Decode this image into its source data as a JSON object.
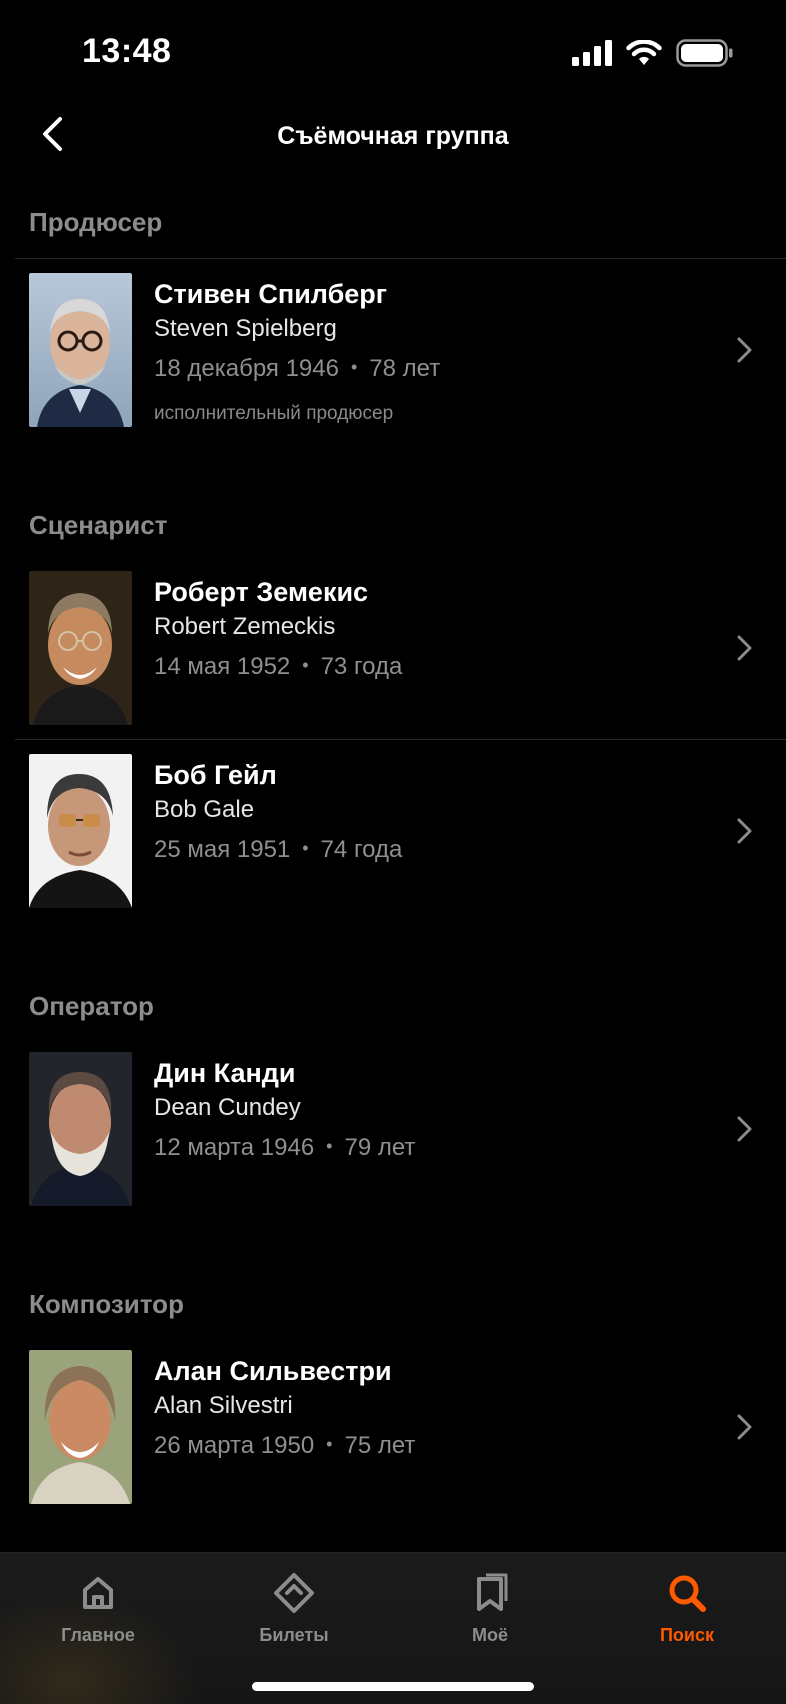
{
  "status_bar": {
    "time": "13:48"
  },
  "nav": {
    "title": "Съёмочная группа"
  },
  "sections": [
    {
      "title": "Продюсер",
      "people": [
        {
          "name": "Стивен Спилберг",
          "original_name": "Steven Spielberg",
          "birth_date": "18 декабря 1946",
          "age": "78 лет",
          "role": "исполнительный продюсер"
        }
      ]
    },
    {
      "title": "Сценарист",
      "people": [
        {
          "name": "Роберт Земекис",
          "original_name": "Robert Zemeckis",
          "birth_date": "14 мая 1952",
          "age": "73 года"
        },
        {
          "name": "Боб Гейл",
          "original_name": "Bob Gale",
          "birth_date": "25 мая 1951",
          "age": "74 года"
        }
      ]
    },
    {
      "title": "Оператор",
      "people": [
        {
          "name": "Дин Канди",
          "original_name": "Dean Cundey",
          "birth_date": "12 марта 1946",
          "age": "79 лет"
        }
      ]
    },
    {
      "title": "Композитор",
      "people": [
        {
          "name": "Алан Сильвестри",
          "original_name": "Alan Silvestri",
          "birth_date": "26 марта 1950",
          "age": "75 лет"
        }
      ]
    }
  ],
  "tab_bar": {
    "items": [
      {
        "label": "Главное",
        "icon": "home-icon"
      },
      {
        "label": "Билеты",
        "icon": "ticket-icon"
      },
      {
        "label": "Моё",
        "icon": "bookmark-icon"
      },
      {
        "label": "Поиск",
        "icon": "search-icon",
        "active": true
      }
    ],
    "active_color": "#ff5a00",
    "inactive_color": "#8c8c8c"
  }
}
